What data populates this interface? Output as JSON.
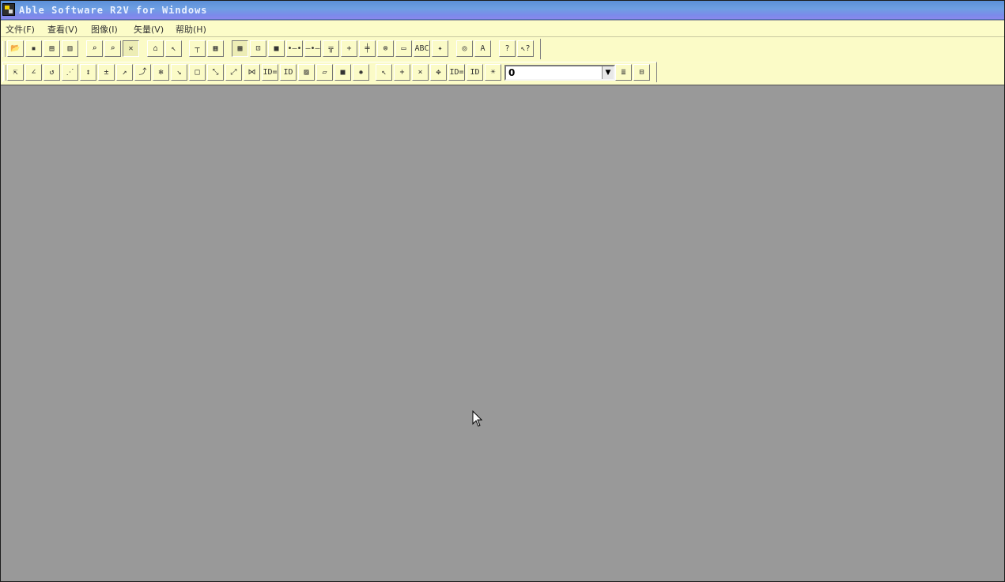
{
  "window": {
    "title": "Able Software R2V for Windows",
    "icon": "r2v-app-icon"
  },
  "menu": [
    {
      "id": "file",
      "label": "文件(F)"
    },
    {
      "id": "view",
      "label": "查看(V)"
    },
    {
      "id": "image",
      "label": "图像(I)"
    },
    {
      "id": "vector",
      "label": "矢量(V)"
    },
    {
      "id": "help",
      "label": "帮助(H)"
    }
  ],
  "toolbar1": [
    {
      "name": "open-file-button",
      "icon": "folder-open-icon",
      "glyph": "📂"
    },
    {
      "name": "save-button",
      "icon": "floppy-disk-icon",
      "glyph": "▪"
    },
    {
      "name": "save-image-button",
      "icon": "save-image-icon",
      "glyph": "▤"
    },
    {
      "name": "save-vector-button",
      "icon": "save-vector-icon",
      "glyph": "▥"
    },
    {
      "name": "zoom-in-button",
      "icon": "magnifier-plus-icon",
      "glyph": "⌕"
    },
    {
      "name": "zoom-out-button",
      "icon": "magnifier-minus-icon",
      "glyph": "⌕"
    },
    {
      "name": "vector-edit-button",
      "icon": "vector-pen-icon",
      "glyph": "✕",
      "pressed": true
    },
    {
      "name": "erase-button",
      "icon": "eraser-icon",
      "glyph": "⌂"
    },
    {
      "name": "select-button",
      "icon": "arrow-pointer-icon",
      "glyph": "↖"
    },
    {
      "name": "trace-button",
      "icon": "trace-icon",
      "glyph": "┬"
    },
    {
      "name": "auto-trace-button",
      "icon": "auto-trace-icon",
      "glyph": "▦"
    },
    {
      "name": "show-image-button",
      "icon": "image-frame-icon",
      "glyph": "▩",
      "pressed": true
    },
    {
      "name": "show-vector-button",
      "icon": "vector-frame-icon",
      "glyph": "⊡"
    },
    {
      "name": "show-both-button",
      "icon": "filled-frame-icon",
      "glyph": "■"
    },
    {
      "name": "node-button",
      "icon": "node-link-icon",
      "glyph": "•–•"
    },
    {
      "name": "segment-button",
      "icon": "segment-icon",
      "glyph": "–•–"
    },
    {
      "name": "join-button",
      "icon": "join-icon",
      "glyph": "╦"
    },
    {
      "name": "point-button",
      "icon": "point-icon",
      "glyph": "+"
    },
    {
      "name": "vertical-point-button",
      "icon": "vertical-point-icon",
      "glyph": "╪"
    },
    {
      "name": "delete-point-button",
      "icon": "x-circle-icon",
      "glyph": "⊗"
    },
    {
      "name": "ocr-button",
      "icon": "ocr-text-icon",
      "glyph": "▭"
    },
    {
      "name": "text-button",
      "icon": "abc-text-icon",
      "glyph": "ABC"
    },
    {
      "name": "control-point-button",
      "icon": "crosshair-icon",
      "glyph": "✦"
    },
    {
      "name": "locate-button",
      "icon": "locate-icon",
      "glyph": "◎"
    },
    {
      "name": "label-button",
      "icon": "label-cursor-icon",
      "glyph": "A"
    },
    {
      "name": "help-button",
      "icon": "question-mark-icon",
      "glyph": "?"
    },
    {
      "name": "context-help-button",
      "icon": "arrow-question-icon",
      "glyph": "↖?"
    }
  ],
  "toolbar2": [
    {
      "name": "edit-vector-button",
      "icon": "vector-select-icon",
      "glyph": "⇱"
    },
    {
      "name": "draw-line-button",
      "icon": "draw-line-icon",
      "glyph": "∠"
    },
    {
      "name": "draw-curve-button",
      "icon": "draw-curve-icon",
      "glyph": "↺"
    },
    {
      "name": "add-node-button",
      "icon": "add-node-icon",
      "glyph": "⋰"
    },
    {
      "name": "move-node-vertical-button",
      "icon": "vertical-move-icon",
      "glyph": "↕"
    },
    {
      "name": "split-line-button",
      "icon": "split-icon",
      "glyph": "±"
    },
    {
      "name": "extend-line-button",
      "icon": "extend-icon",
      "glyph": "↗"
    },
    {
      "name": "snap-line-button",
      "icon": "snap-icon",
      "glyph": "⤴"
    },
    {
      "name": "break-line-button",
      "icon": "break-icon",
      "glyph": "✻"
    },
    {
      "name": "delete-segment-button",
      "icon": "delete-segment-icon",
      "glyph": "↘"
    },
    {
      "name": "rectangle-button",
      "icon": "rectangle-icon",
      "glyph": "□"
    },
    {
      "name": "connect-button",
      "icon": "connect-diagonal-icon",
      "glyph": "⤡"
    },
    {
      "name": "smooth-button",
      "icon": "smooth-icon",
      "glyph": "⤢"
    },
    {
      "name": "merge-button",
      "icon": "merge-icon",
      "glyph": "⋈"
    },
    {
      "name": "id-assign-button",
      "icon": "id-assign-icon",
      "glyph": "ID="
    },
    {
      "name": "id-label-button",
      "icon": "id-label-icon",
      "glyph": "ID"
    },
    {
      "name": "hatch-button",
      "icon": "hatch-icon",
      "glyph": "▨"
    },
    {
      "name": "polygon-button",
      "icon": "polygon-icon",
      "glyph": "▱"
    },
    {
      "name": "fill-button",
      "icon": "fill-area-icon",
      "glyph": "■"
    },
    {
      "name": "explode-button",
      "icon": "explode-icon",
      "glyph": "✹"
    },
    {
      "name": "select-point-button",
      "icon": "point-select-icon",
      "glyph": "↖"
    },
    {
      "name": "add-point-button",
      "icon": "add-point-icon",
      "glyph": "+"
    },
    {
      "name": "remove-point-button",
      "icon": "remove-point-icon",
      "glyph": "×"
    },
    {
      "name": "move-point-button",
      "icon": "move-point-icon",
      "glyph": "✥"
    },
    {
      "name": "point-id-assign-button",
      "icon": "point-id-assign-icon",
      "glyph": "ID="
    },
    {
      "name": "point-id-button",
      "icon": "point-id-icon",
      "glyph": "ID"
    },
    {
      "name": "lightbulb-button",
      "icon": "lightbulb-icon",
      "glyph": "☀"
    },
    {
      "name": "layer-list-button",
      "icon": "layer-list-icon",
      "glyph": "≣"
    },
    {
      "name": "layer-frame-button",
      "icon": "layer-frame-icon",
      "glyph": "⊟"
    }
  ],
  "id_combo": {
    "value": "0",
    "arrow": "▼"
  },
  "colors": {
    "titlebar": "#6e9fe2",
    "menubar": "#fcfcc8",
    "toolbar": "#fbfbc7",
    "workspace": "#999999"
  }
}
